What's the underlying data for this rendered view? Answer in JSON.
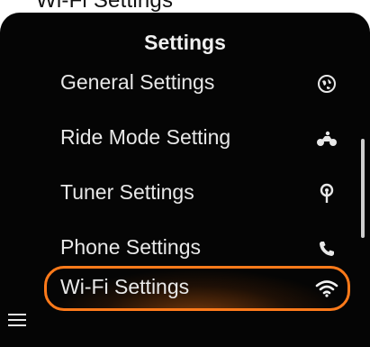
{
  "top_strip": {
    "text": "Wi-Fi Settings"
  },
  "header": {
    "title": "Settings"
  },
  "menu": {
    "items": [
      {
        "label": "General Settings",
        "icon": "globe-icon"
      },
      {
        "label": "Ride Mode Setting",
        "icon": "motorcycle-icon"
      },
      {
        "label": "Tuner Settings",
        "icon": "antenna-icon"
      },
      {
        "label": "Phone Settings",
        "icon": "phone-icon"
      },
      {
        "label": "Wi-Fi Settings",
        "icon": "wifi-icon",
        "selected": true
      }
    ]
  },
  "colors": {
    "background": "#050505",
    "text": "#e8e8e8",
    "accent": "#ff7a1a"
  },
  "footer": {
    "menu_icon": "hamburger-icon"
  }
}
